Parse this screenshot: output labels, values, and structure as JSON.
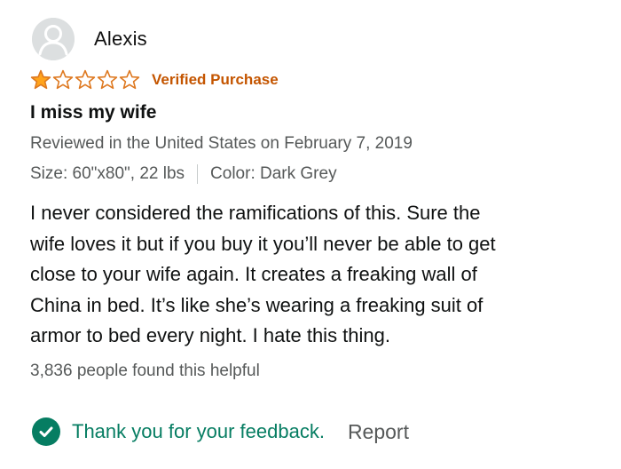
{
  "review": {
    "profile": {
      "name": "Alexis",
      "avatar_icon": "default-user-silhouette-icon"
    },
    "rating": {
      "value": 1,
      "max": 5,
      "filled_color": "#ffa41c",
      "empty_color": "#de7921"
    },
    "verified_label": "Verified Purchase",
    "title": "I miss my wife",
    "date": "Reviewed in the United States on February 7, 2019",
    "variant": {
      "size": "Size: 60\"x80\", 22 lbs",
      "color": "Color: Dark Grey"
    },
    "body_lines": [
      "I never considered the ramifications of this. Sure the",
      "wife loves it but if you buy it you’ll never be able to get",
      "close to your wife again. It creates a freaking wall of",
      "China in bed. It’s like she’s wearing a freaking suit of",
      "armor to bed every night. I hate this thing."
    ],
    "helpful_count_text": "3,836 people found this helpful",
    "feedback": {
      "icon": "check-circle-icon",
      "text": "Thank you for your feedback.",
      "report_label": "Report"
    },
    "colors": {
      "verified": "#c45500",
      "feedback": "#067d62",
      "secondary_text": "#565959"
    }
  }
}
